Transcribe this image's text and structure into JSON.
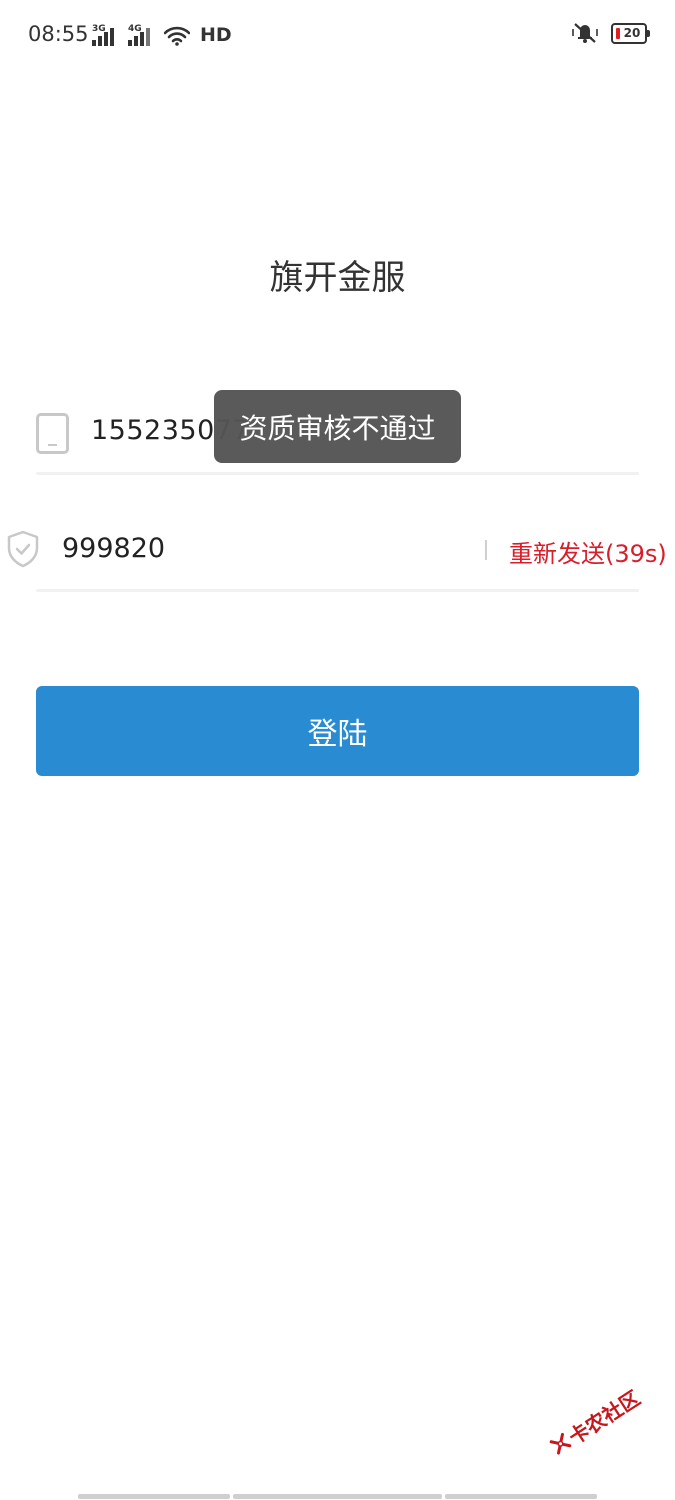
{
  "status_bar": {
    "time": "08:55",
    "signal1_tag": "3G",
    "signal2_tag": "4G",
    "network": "HD",
    "battery_level": "20",
    "icons": [
      "signal-3g-icon",
      "signal-4g-icon",
      "wifi-icon",
      "mute-vibrate-icon",
      "battery-icon"
    ]
  },
  "app": {
    "title": "旗开金服"
  },
  "form": {
    "phone_value": "155235077",
    "code_value": "999820",
    "resend_label": "重新发送(39s)",
    "login_label": "登陆"
  },
  "toast": {
    "message": "资质审核不通过"
  },
  "watermark": {
    "text": "卡农社区"
  },
  "colors": {
    "primary": "#298cd3",
    "accent_red": "#d81e2a",
    "toast_bg": "#555555"
  }
}
